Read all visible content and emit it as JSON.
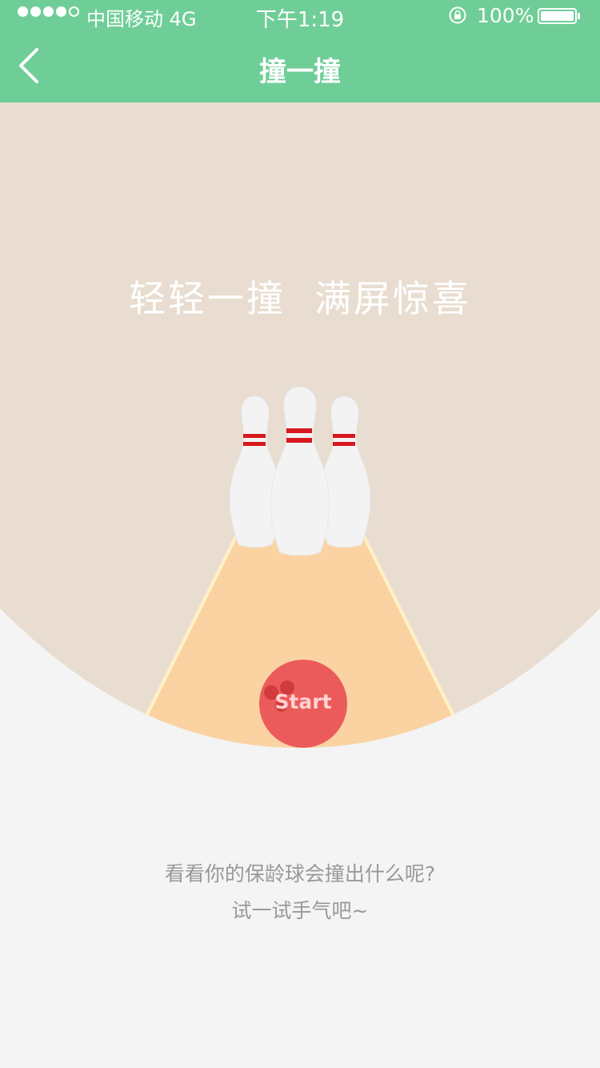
{
  "status_bar": {
    "carrier": "中国移动 4G",
    "time": "下午1:19",
    "battery": "100%",
    "signal_bars_filled": 4,
    "signal_bars_total": 5
  },
  "nav": {
    "title": "撞一撞"
  },
  "hero": {
    "tagline_left": "轻轻一撞",
    "tagline_right": "满屏惊喜",
    "start_label": "Start"
  },
  "footer": {
    "line1": "看看你的保龄球会撞出什么呢?",
    "line2": "试一试手气吧~"
  },
  "colors": {
    "header_green": "#6fce97",
    "stage_beige": "#e8ddd0",
    "lane_orange": "#fbd3a3",
    "ball_red": "#ec5b5b",
    "pin_stripe": "#d7191f"
  }
}
